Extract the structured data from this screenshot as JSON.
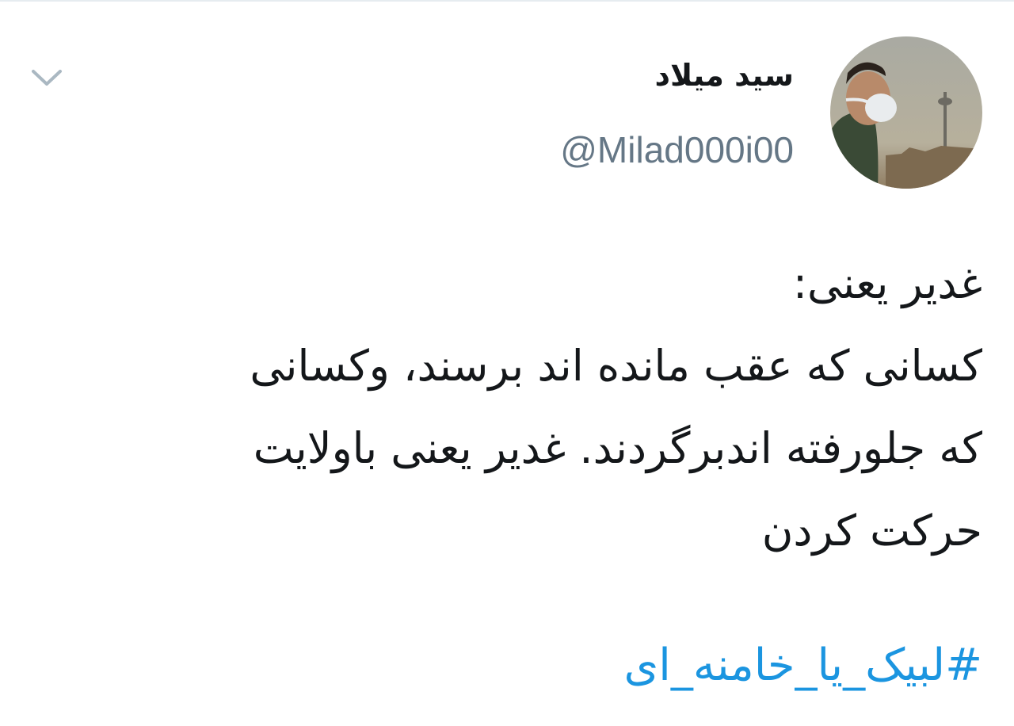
{
  "tweet": {
    "author": {
      "display_name": "سید میلاد",
      "handle": "@Milad000i00"
    },
    "body_lines": [
      "غدیر یعنی:",
      "کسانی که عقب مانده اند برسند، وکسانی",
      "که جلورفته اندبرگردند. غدیر یعنی باولایت",
      "حرکت کردن"
    ],
    "hashtag": "#لبیک_یا_خامنه_ای"
  },
  "colors": {
    "text": "#14171a",
    "secondary_text": "#657786",
    "link": "#1b95e0",
    "divider": "#e6ecf0"
  },
  "icons": {
    "menu": "chevron-down-icon",
    "avatar": "profile-photo"
  }
}
